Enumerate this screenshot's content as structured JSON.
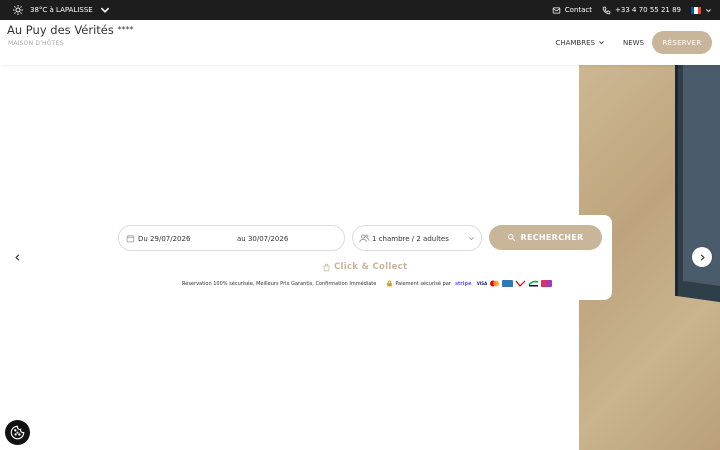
{
  "topbar": {
    "weather": "38°C à LAPALISSE",
    "contact": "Contact",
    "phone": "+33 4 70 55 21 89",
    "flag_colors": [
      "#0055a4",
      "#ffffff",
      "#ef4135"
    ]
  },
  "header": {
    "title": "Au Puy des Vérités",
    "stars": "****",
    "subtitle": "MAISON D'HÔTES",
    "nav": {
      "chambres": "CHAMBRES",
      "news": "NEWS",
      "reserver": "RÉSERVER"
    }
  },
  "booking": {
    "date_from": "Du 29/07/2026",
    "date_to": "au 30/07/2026",
    "guests": "1 chambre / 2 adultes",
    "search": "RECHERCHER",
    "click_collect": "Click & Collect",
    "secure_text": "Réservation 100% sécurisée, Meilleurs Prix Garantis, Confirmation Immédiate",
    "payment_text": "Paiement sécurisé par",
    "stripe": "stripe",
    "visa": "VISA"
  },
  "colors": {
    "accent": "#c9b59a",
    "dark": "#1d1d1d"
  },
  "icons": [
    "sun-icon",
    "chevron-down-icon",
    "mail-icon",
    "phone-icon",
    "calendar-icon",
    "users-icon",
    "search-icon",
    "bag-icon",
    "lock-icon",
    "chevron-left-icon",
    "chevron-right-icon",
    "cookie-icon"
  ]
}
